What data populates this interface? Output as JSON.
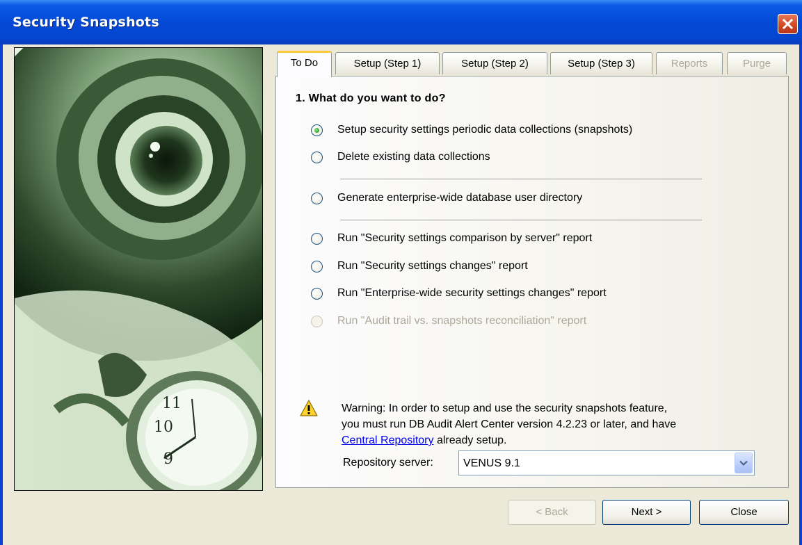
{
  "window": {
    "title": "Security Snapshots",
    "accent_color": "#0a3fd8"
  },
  "tabs": [
    {
      "label": "To Do",
      "state": "active"
    },
    {
      "label": "Setup (Step 1)",
      "state": "enabled"
    },
    {
      "label": "Setup (Step 2)",
      "state": "enabled"
    },
    {
      "label": "Setup (Step 3)",
      "state": "enabled"
    },
    {
      "label": "Reports",
      "state": "disabled"
    },
    {
      "label": "Purge",
      "state": "disabled"
    }
  ],
  "todo": {
    "question": "1. What do you want to do?",
    "options": [
      {
        "label": "Setup security settings periodic data collections (snapshots)",
        "checked": true,
        "enabled": true
      },
      {
        "label": "Delete existing data collections",
        "checked": false,
        "enabled": true
      },
      {
        "label": "Generate enterprise-wide database user directory",
        "checked": false,
        "enabled": true
      },
      {
        "label": "Run \"Security settings comparison by server\" report",
        "checked": false,
        "enabled": true
      },
      {
        "label": "Run \"Security settings changes\" report",
        "checked": false,
        "enabled": true
      },
      {
        "label": "Run \"Enterprise-wide security settings changes\" report",
        "checked": false,
        "enabled": true
      },
      {
        "label": "Run \"Audit trail vs. snapshots reconciliation\" report",
        "checked": false,
        "enabled": false
      }
    ],
    "warning": {
      "icon": "warning-icon",
      "line1": "Warning: In order to setup and use the security snapshots feature,",
      "line2": "you must run DB Audit Alert Center version 4.2.23 or later, and have",
      "link": "Central Repository",
      "line3_suffix": " already setup."
    },
    "repository": {
      "label": "Repository server:",
      "value": "VENUS 9.1"
    }
  },
  "buttons": {
    "back": "< Back",
    "next": "Next >",
    "close": "Close"
  }
}
